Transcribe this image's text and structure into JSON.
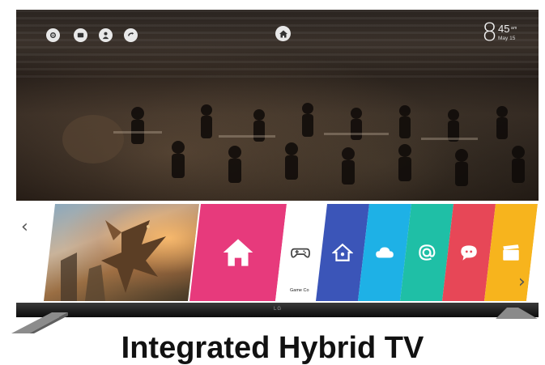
{
  "status_bar": {
    "icons": [
      "settings-icon",
      "input-icon",
      "profile-icon",
      "network-icon"
    ],
    "home_icon": "home-icon"
  },
  "clock": {
    "hour": "8",
    "minutes": "45",
    "ampm": "am",
    "date": "May 15"
  },
  "launcher": {
    "prev_arrow": "‹",
    "next_arrow": "›",
    "cards": [
      {
        "name": "featured-content",
        "color": "#6b5a3e",
        "icon": "dragon-artwork"
      },
      {
        "name": "home",
        "color": "#e73a7c",
        "icon": "home-icon"
      },
      {
        "name": "game-console",
        "color": "#ffffff",
        "icon": "gamepad-icon",
        "label": "Game Co"
      },
      {
        "name": "smart-home",
        "color": "#3b55b8",
        "icon": "home-icon"
      },
      {
        "name": "cloud",
        "color": "#1eb1e6",
        "icon": "cloud-icon"
      },
      {
        "name": "web-browser",
        "color": "#1fbfa6",
        "icon": "at-icon"
      },
      {
        "name": "chat",
        "color": "#e74757",
        "icon": "speech-bubble-icon"
      },
      {
        "name": "video",
        "color": "#f7b41d",
        "icon": "clapper-icon"
      },
      {
        "name": "more",
        "color": "#ffffff",
        "icon": "blank"
      }
    ]
  },
  "brand": {
    "logo": "LG"
  },
  "caption": "Integrated Hybrid TV"
}
